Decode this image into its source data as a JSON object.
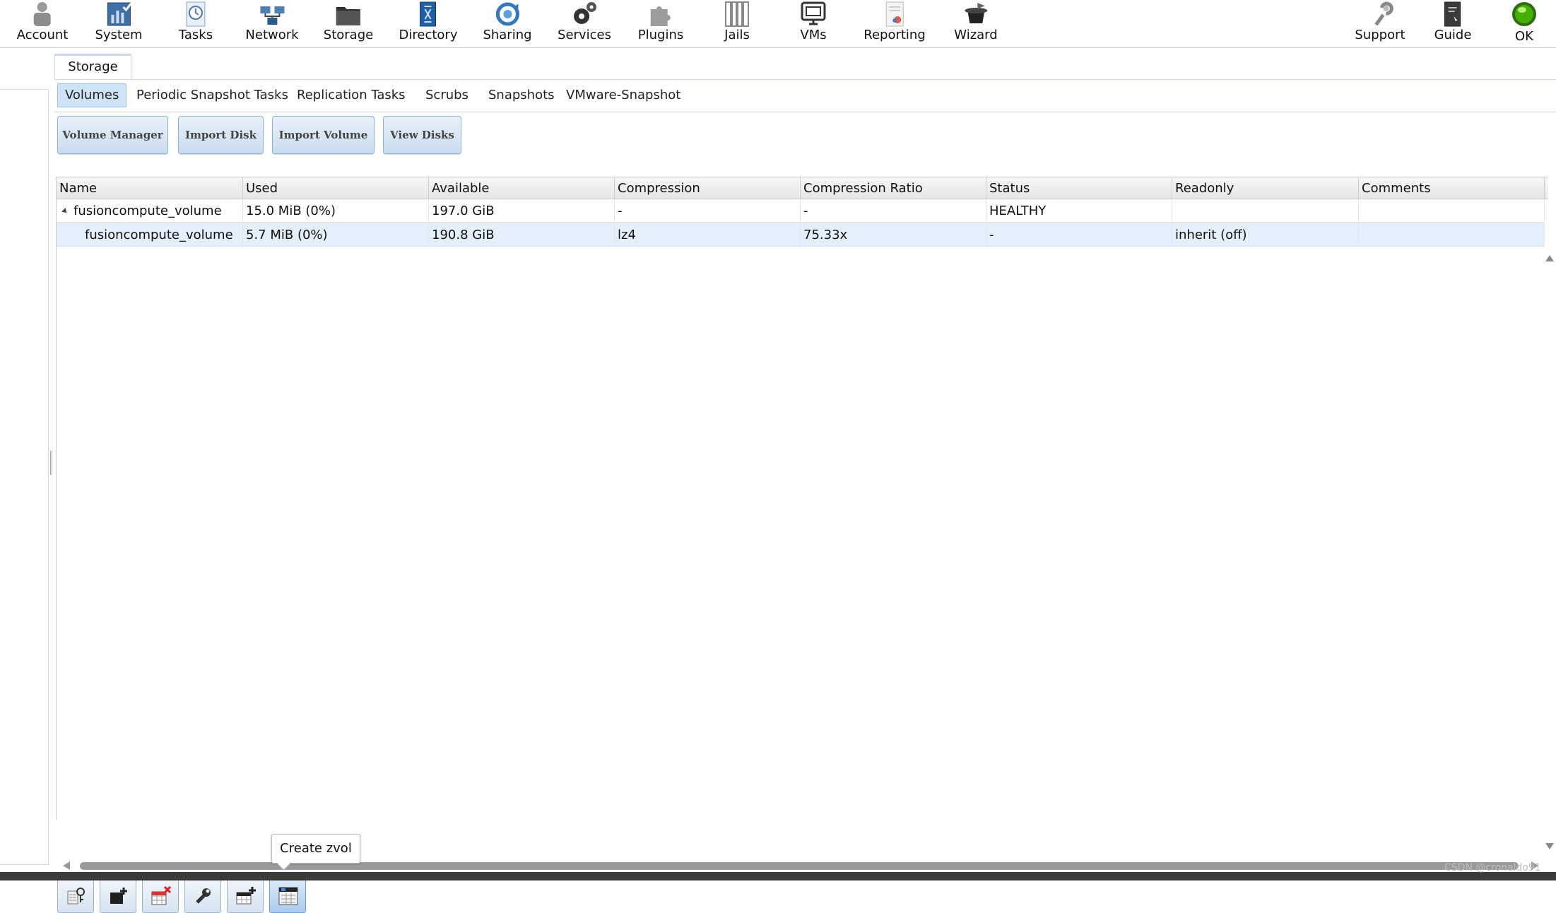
{
  "nav": {
    "items": [
      {
        "label": "Account",
        "icon": "account-icon"
      },
      {
        "label": "System",
        "icon": "system-icon"
      },
      {
        "label": "Tasks",
        "icon": "tasks-icon"
      },
      {
        "label": "Network",
        "icon": "network-icon"
      },
      {
        "label": "Storage",
        "icon": "storage-icon"
      },
      {
        "label": "Directory",
        "icon": "directory-icon"
      },
      {
        "label": "Sharing",
        "icon": "sharing-icon"
      },
      {
        "label": "Services",
        "icon": "services-icon"
      },
      {
        "label": "Plugins",
        "icon": "plugins-icon"
      },
      {
        "label": "Jails",
        "icon": "jails-icon"
      },
      {
        "label": "VMs",
        "icon": "vms-icon"
      },
      {
        "label": "Reporting",
        "icon": "reporting-icon"
      },
      {
        "label": "Wizard",
        "icon": "wizard-icon"
      }
    ],
    "right_items": [
      {
        "label": "Support",
        "icon": "support-icon"
      },
      {
        "label": "Guide",
        "icon": "guide-icon"
      },
      {
        "label": "OK",
        "icon": "alert-status-icon"
      }
    ]
  },
  "main": {
    "tab": "Storage",
    "subtabs": [
      "Volumes",
      "Periodic Snapshot Tasks",
      "Replication Tasks",
      "Scrubs",
      "Snapshots",
      "VMware-Snapshot"
    ],
    "active_subtab": "Volumes",
    "actions": [
      "Volume Manager",
      "Import Disk",
      "Import Volume",
      "View Disks"
    ]
  },
  "grid": {
    "columns": [
      "Name",
      "Used",
      "Available",
      "Compression",
      "Compression Ratio",
      "Status",
      "Readonly",
      "Comments"
    ],
    "rows": [
      {
        "name": "fusioncompute_volume",
        "used": "15.0 MiB (0%)",
        "available": "197.0 GiB",
        "compression": "-",
        "ratio": "-",
        "status": "HEALTHY",
        "readonly": "",
        "comments": ""
      },
      {
        "name": "fusioncompute_volume",
        "used": "5.7 MiB (0%)",
        "available": "190.8 GiB",
        "compression": "lz4",
        "ratio": "75.33x",
        "status": "-",
        "readonly": "inherit (off)",
        "comments": ""
      }
    ]
  },
  "bottom_toolbar": {
    "buttons": [
      "change-permissions-icon",
      "create-dataset-icon",
      "detach-volume-icon",
      "scrub-volume-icon",
      "create-snapshot-icon",
      "create-zvol-icon"
    ],
    "tooltip": "Create zvol"
  },
  "watermark": "CSDN @cronaldo91",
  "colors": {
    "accent": "#cfe3f7",
    "selected_row": "#e3effa",
    "button_border": "#8fb2d4",
    "status_ok": "#44b000"
  }
}
